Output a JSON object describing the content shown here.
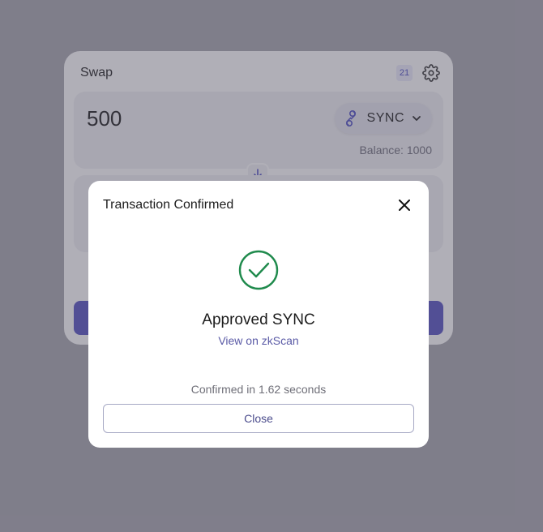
{
  "swap": {
    "title": "Swap",
    "tx_count": "21",
    "input": {
      "amount": "500",
      "token": "SYNC",
      "balance": "Balance: 1000"
    },
    "accent_color": "#5451c2"
  },
  "modal": {
    "title": "Transaction Confirmed",
    "status": "Approved SYNC",
    "link_text": "View on zkScan",
    "confirmed_text": "Confirmed in 1.62 seconds",
    "close_label": "Close",
    "success_color": "#1f8a4c"
  },
  "icons": {
    "settings": "gear-icon",
    "token": "sync-token-icon",
    "dropdown": "chevron-down-icon",
    "switch": "arrow-down-icon",
    "close": "close-icon",
    "success": "check-circle-icon"
  }
}
